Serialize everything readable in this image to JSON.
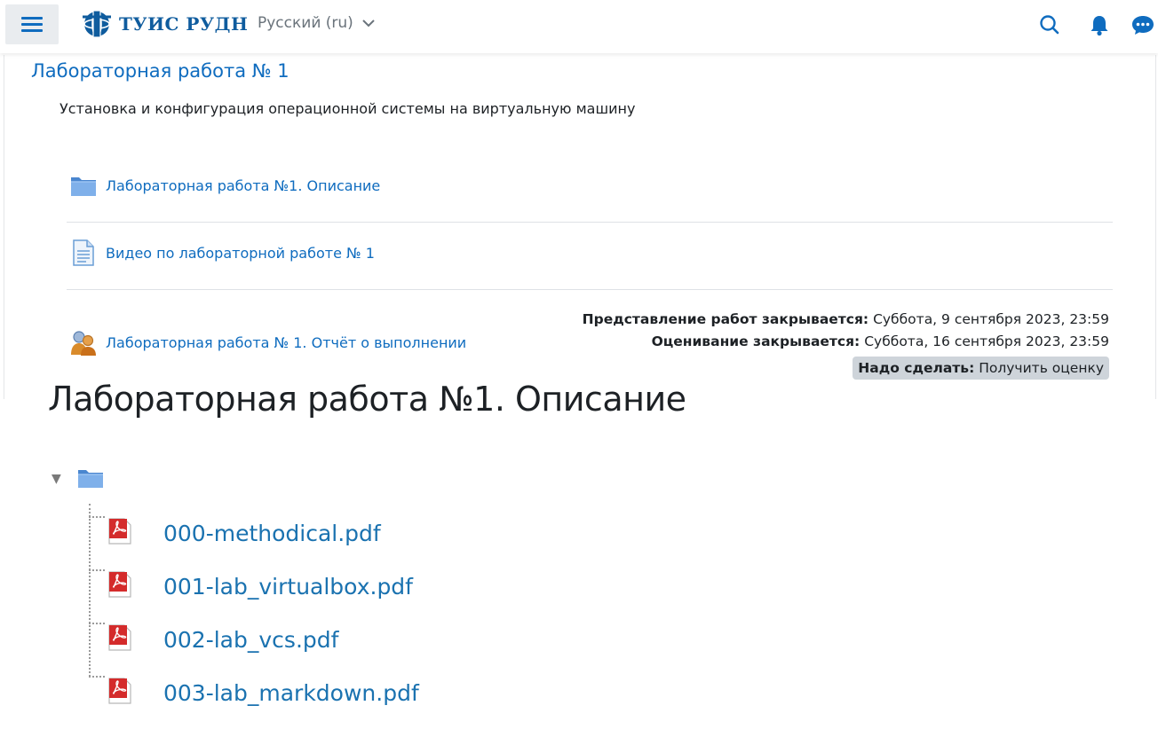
{
  "navbar": {
    "logo_text": "ТУИС РУДН",
    "language": "Русский (ru)",
    "icons": [
      "menu-icon",
      "search-icon",
      "bell-icon",
      "chat-icon"
    ],
    "accent_color": "#0f6cbf"
  },
  "section": {
    "title": "Лабораторная работа № 1",
    "summary": "Установка и конфигурация операционной системы на виртуальную машину",
    "activities": [
      {
        "label": "Лабораторная работа №1. Описание",
        "icon": "folder-icon"
      },
      {
        "label": "Видео по лабораторной работе № 1",
        "icon": "page-icon"
      },
      {
        "label": "Лабораторная работа № 1. Отчёт о выполнении",
        "icon": "assignment-icon"
      }
    ],
    "dates": {
      "submission_label": "Представление работ закрывается:",
      "submission_value": "Суббота, 9 сентября 2023, 23:59",
      "grading_label": "Оценивание закрывается:",
      "grading_value": "Суббота, 16 сентября 2023, 23:59"
    },
    "todo": {
      "label": "Надо сделать:",
      "value": "Получить оценку"
    }
  },
  "folder": {
    "title": "Лабораторная работа №1. Описание",
    "toggle_icon": "▼",
    "files": [
      {
        "name": "000-methodical.pdf",
        "icon": "pdf-icon"
      },
      {
        "name": "001-lab_virtualbox.pdf",
        "icon": "pdf-icon"
      },
      {
        "name": "002-lab_vcs.pdf",
        "icon": "pdf-icon"
      },
      {
        "name": "003-lab_markdown.pdf",
        "icon": "pdf-icon"
      }
    ]
  }
}
